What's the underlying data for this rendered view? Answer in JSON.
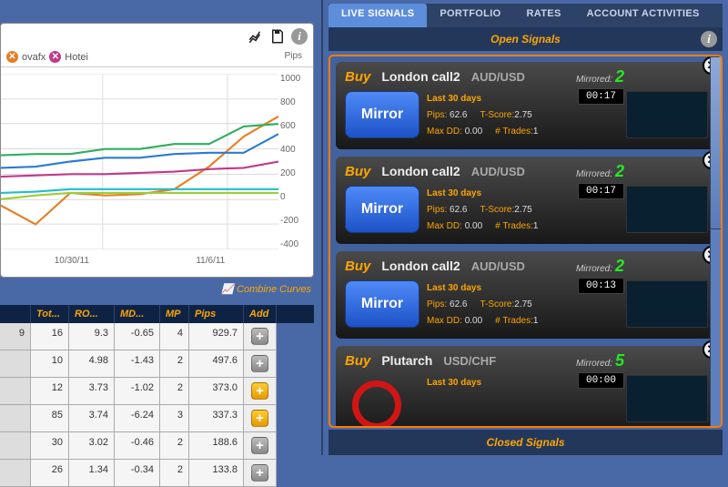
{
  "tabs": {
    "live": "LIVE SIGNALS",
    "portfolio": "PORTFOLIO",
    "rates": "RATES",
    "account": "ACCOUNT ACTIVITIES"
  },
  "section_open": "Open Signals",
  "section_closed": "Closed Signals",
  "chart": {
    "traders": [
      {
        "name": "ovafx"
      },
      {
        "name": "Hotei"
      }
    ],
    "pips_label": "Pips",
    "yticks": [
      "1000",
      "800",
      "600",
      "400",
      "200",
      "0",
      "-200",
      "-400"
    ],
    "xticks": [
      "10/30/11",
      "11/6/11"
    ],
    "combine": "Combine Curves"
  },
  "toolbar_icons": {
    "chart": "chart",
    "save": "save",
    "info": "i"
  },
  "grid": {
    "headers": [
      "",
      "Tot...",
      "RO...",
      "MD...",
      "MP",
      "Pips",
      "Add"
    ],
    "rows": [
      {
        "c": [
          "9",
          "16",
          "9.3",
          "-0.65",
          "4",
          "929.7"
        ],
        "gold": false
      },
      {
        "c": [
          "",
          "10",
          "4.98",
          "-1.43",
          "2",
          "497.6"
        ],
        "gold": false
      },
      {
        "c": [
          "",
          "12",
          "3.73",
          "-1.02",
          "2",
          "373.0"
        ],
        "gold": true
      },
      {
        "c": [
          "",
          "85",
          "3.74",
          "-6.24",
          "3",
          "337.3"
        ],
        "gold": true
      },
      {
        "c": [
          "",
          "30",
          "3.02",
          "-0.46",
          "2",
          "188.6"
        ],
        "gold": false
      },
      {
        "c": [
          "",
          "26",
          "1.34",
          "-0.34",
          "2",
          "133.8"
        ],
        "gold": false
      }
    ]
  },
  "signals": [
    {
      "action": "Buy",
      "name": "London call2",
      "pair": "AUD/USD",
      "mirrored": "Mirrored:",
      "count": "2",
      "time": "00:17",
      "button": "Mirror",
      "days": "Last 30 days",
      "pips_l": "Pips:",
      "pips_v": "62.6",
      "ts_l": "T-Score:",
      "ts_v": "2.75",
      "dd_l": "Max DD:",
      "dd_v": "0.00",
      "tr_l": "# Trades:",
      "tr_v": "1",
      "type": "mirror"
    },
    {
      "action": "Buy",
      "name": "London call2",
      "pair": "AUD/USD",
      "mirrored": "Mirrored:",
      "count": "2",
      "time": "00:17",
      "button": "Mirror",
      "days": "Last 30 days",
      "pips_l": "Pips:",
      "pips_v": "62.6",
      "ts_l": "T-Score:",
      "ts_v": "2.75",
      "dd_l": "Max DD:",
      "dd_v": "0.00",
      "tr_l": "# Trades:",
      "tr_v": "1",
      "type": "mirror"
    },
    {
      "action": "Buy",
      "name": "London call2",
      "pair": "AUD/USD",
      "mirrored": "Mirrored:",
      "count": "2",
      "time": "00:13",
      "button": "Mirror",
      "days": "Last 30 days",
      "pips_l": "Pips:",
      "pips_v": "62.6",
      "ts_l": "T-Score:",
      "ts_v": "2.75",
      "dd_l": "Max DD:",
      "dd_v": "0.00",
      "tr_l": "# Trades:",
      "tr_v": "1",
      "type": "mirror"
    },
    {
      "action": "Buy",
      "name": "Plutarch",
      "pair": "USD/CHF",
      "mirrored": "Mirrored:",
      "count": "5",
      "time": "00:00",
      "button": "",
      "days": "Last 30 days",
      "pips_l": "",
      "pips_v": "",
      "ts_l": "",
      "ts_v": "",
      "dd_l": "",
      "dd_v": "",
      "tr_l": "",
      "tr_v": "",
      "type": "stop"
    }
  ],
  "chart_data": {
    "type": "line",
    "title": "",
    "xlabel": "",
    "ylabel": "Pips",
    "ylim": [
      -400,
      1000
    ],
    "x": [
      "10/24",
      "10/26",
      "10/28",
      "10/30",
      "11/01",
      "11/03",
      "11/05",
      "11/07",
      "11/09"
    ],
    "series": [
      {
        "name": "orange",
        "color": "#e67e22",
        "values": [
          -50,
          -200,
          50,
          30,
          40,
          80,
          260,
          500,
          660
        ]
      },
      {
        "name": "blue",
        "color": "#2a7ad4",
        "values": [
          250,
          260,
          300,
          330,
          330,
          360,
          370,
          370,
          520
        ]
      },
      {
        "name": "green",
        "color": "#2fae60",
        "values": [
          350,
          360,
          360,
          400,
          400,
          440,
          440,
          580,
          600
        ]
      },
      {
        "name": "lime",
        "color": "#9ccc3c",
        "values": [
          0,
          30,
          50,
          50,
          50,
          50,
          50,
          50,
          50
        ]
      },
      {
        "name": "magenta",
        "color": "#c0398b",
        "values": [
          180,
          190,
          200,
          200,
          210,
          220,
          240,
          250,
          300
        ]
      },
      {
        "name": "cyan",
        "color": "#24bdc9",
        "values": [
          50,
          60,
          80,
          80,
          80,
          80,
          80,
          80,
          80
        ]
      }
    ]
  }
}
